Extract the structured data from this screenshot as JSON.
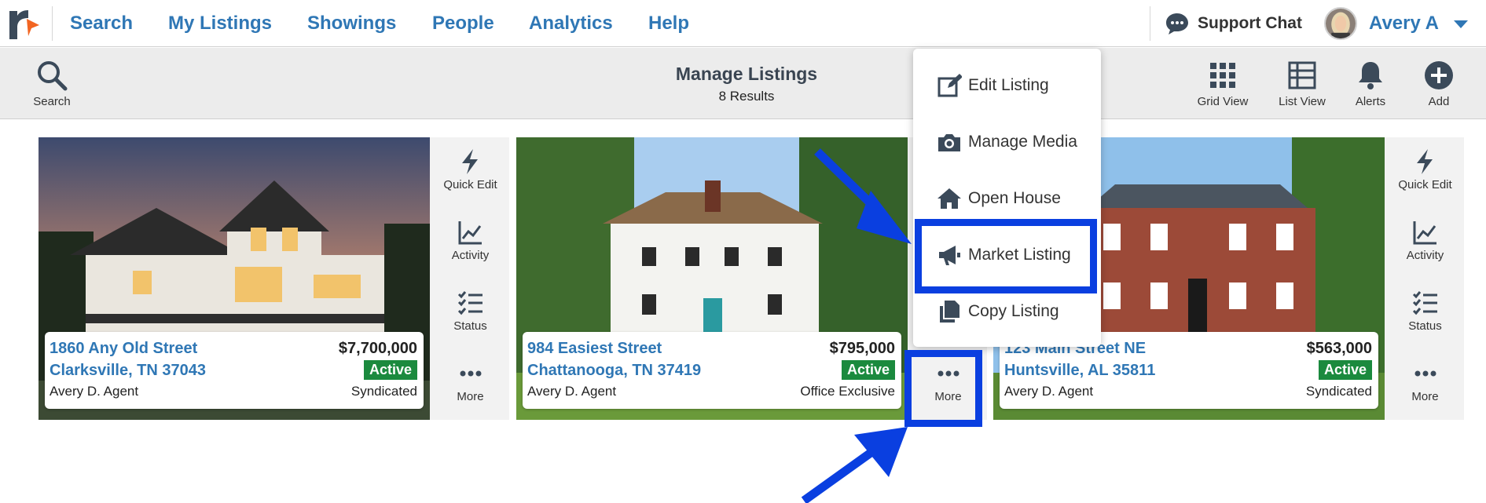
{
  "nav": {
    "links": [
      "Search",
      "My Listings",
      "Showings",
      "People",
      "Analytics",
      "Help"
    ],
    "support_chat": "Support Chat",
    "user_name": "Avery A"
  },
  "toolbar": {
    "search_label": "Search",
    "title": "Manage Listings",
    "results": "8 Results",
    "grid_view_label": "Grid View",
    "list_view_label": "List View",
    "alerts_label": "Alerts",
    "add_label": "Add"
  },
  "side_actions": {
    "quick_edit": "Quick Edit",
    "activity": "Activity",
    "status": "Status",
    "more": "More"
  },
  "listings": [
    {
      "address1": "1860 Any Old Street",
      "address2": "Clarksville, TN 37043",
      "agent": "Avery D. Agent",
      "price": "$7,700,000",
      "status": "Active",
      "distribution": "Syndicated"
    },
    {
      "address1": "984 Easiest Street",
      "address2": "Chattanooga, TN 37419",
      "agent": "Avery D. Agent",
      "price": "$795,000",
      "status": "Active",
      "distribution": "Office Exclusive"
    },
    {
      "address1": "123 Main Street NE",
      "address2": "Huntsville, AL 35811",
      "agent": "Avery D. Agent",
      "price": "$563,000",
      "status": "Active",
      "distribution": "Syndicated"
    }
  ],
  "menu": {
    "items": [
      "Edit Listing",
      "Manage Media",
      "Open House",
      "Market Listing",
      "Copy Listing"
    ]
  },
  "colors": {
    "link_blue": "#2f77b5",
    "active_green": "#1b8a3e",
    "highlight_blue": "#0a3fe0",
    "toolbar_bg": "#ececec"
  }
}
